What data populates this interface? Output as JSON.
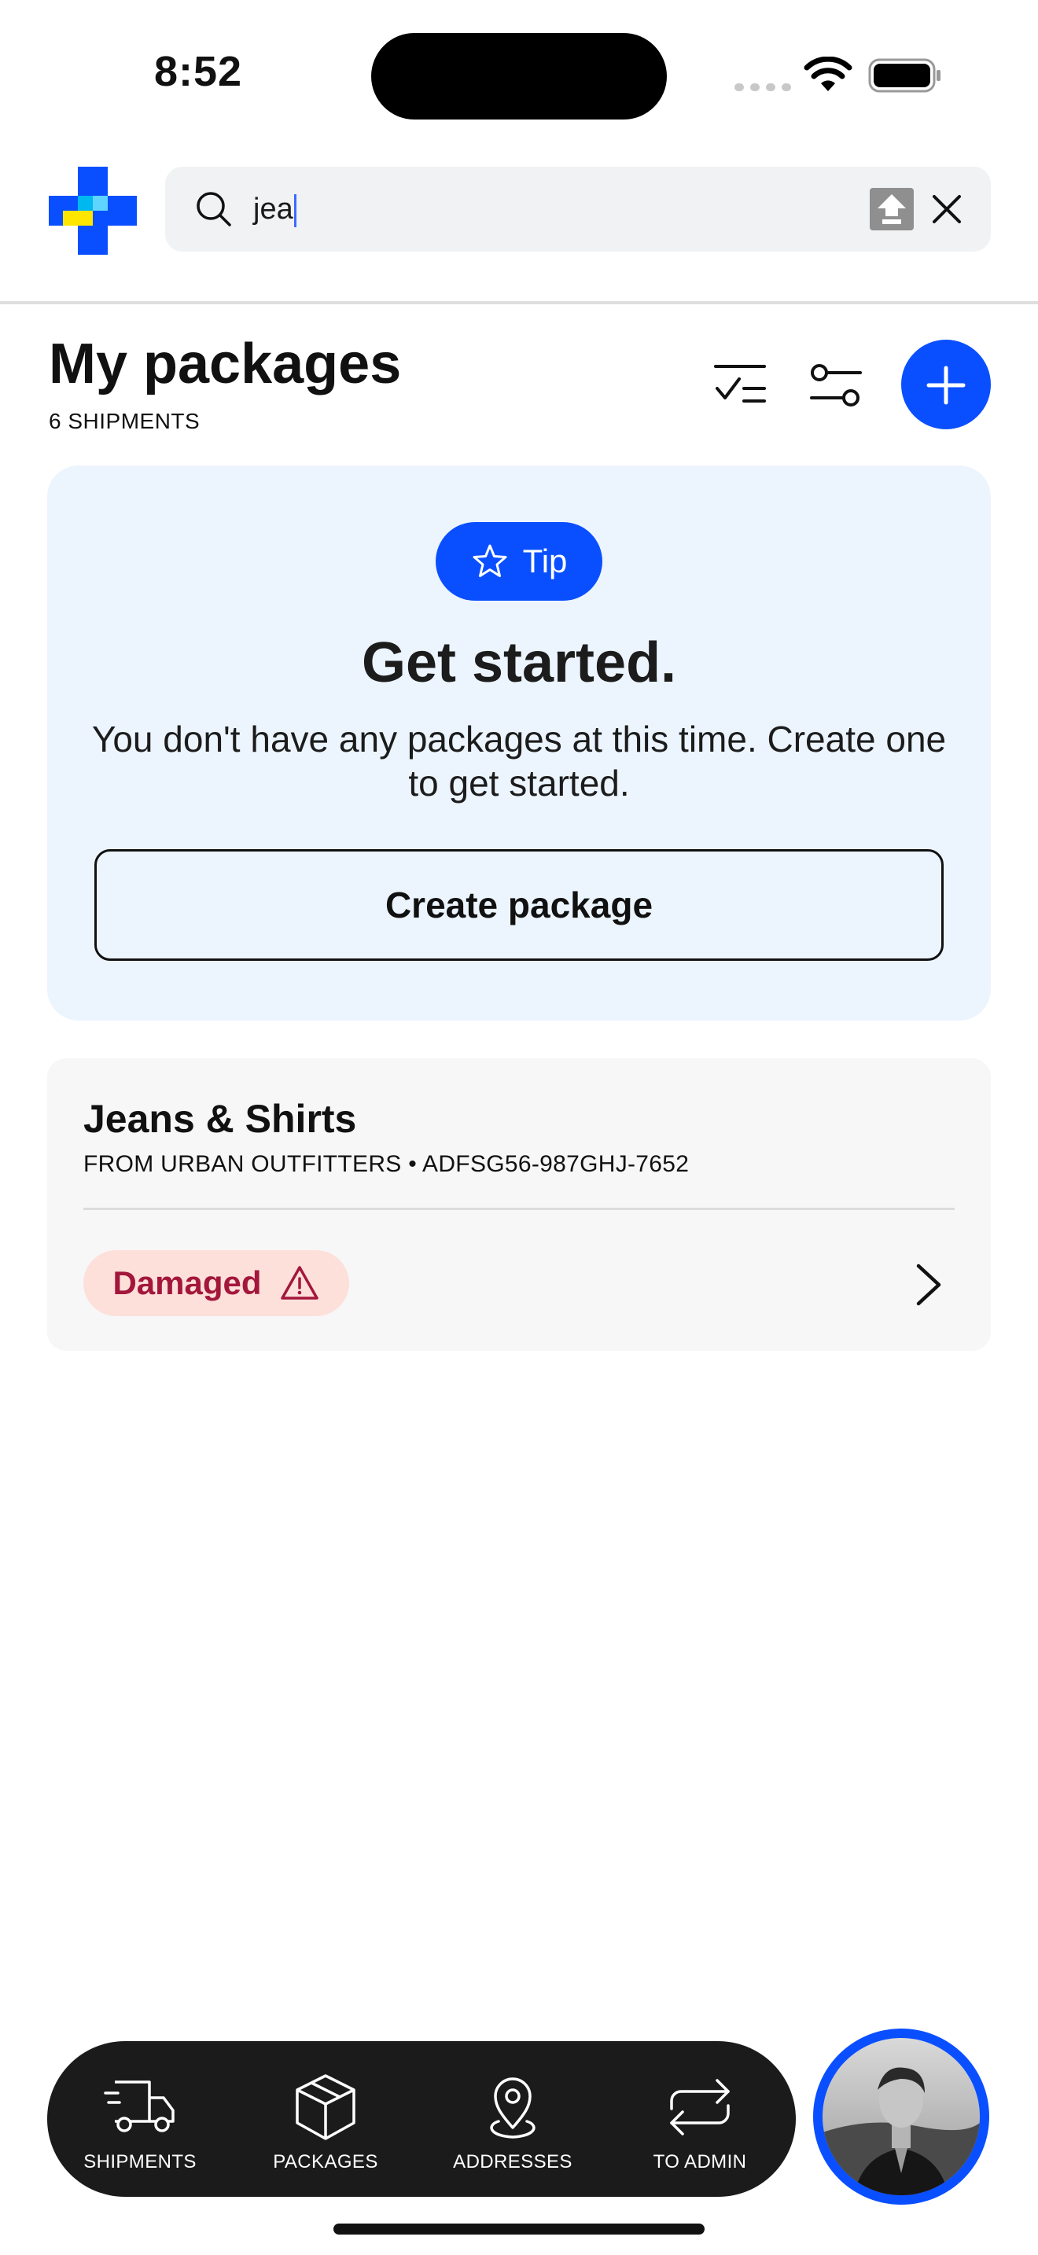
{
  "status_bar": {
    "time": "8:52"
  },
  "search": {
    "value": "jea"
  },
  "header": {
    "title": "My packages",
    "subtitle": "6 SHIPMENTS"
  },
  "tip": {
    "badge_label": "Tip",
    "title": "Get started.",
    "body": "You don't have any packages at this time. Create one to get started.",
    "button_label": "Create package"
  },
  "package": {
    "name": "Jeans & Shirts",
    "meta": "FROM URBAN OUTFITTERS • ADFSG56-987GHJ-7652",
    "status": "Damaged"
  },
  "nav": {
    "items": [
      {
        "label": "SHIPMENTS",
        "icon": "truck-icon"
      },
      {
        "label": "PACKAGES",
        "icon": "box-icon"
      },
      {
        "label": "ADDRESSES",
        "icon": "map-pin-icon"
      },
      {
        "label": "TO ADMIN",
        "icon": "swap-icon"
      }
    ]
  },
  "colors": {
    "accent": "#0a4fff",
    "tip_background": "#ecf5fe",
    "status_damaged_bg": "#fde0da",
    "status_damaged_text": "#a3173c",
    "nav_background": "#1b1b1b"
  }
}
